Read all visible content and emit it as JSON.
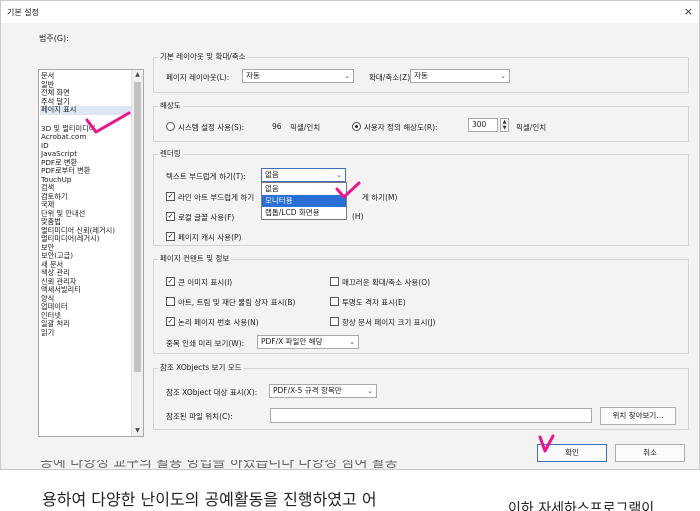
{
  "window": {
    "title": "기본 설정",
    "close_glyph": "×"
  },
  "categories": {
    "label": "범주(G):",
    "group1": [
      "문서",
      "일반",
      "전체 화면",
      "주석 달기",
      "페이지 표시"
    ],
    "group2": [
      "3D 및 멀티미디어",
      "Acrobat.com",
      "ID",
      "JavaScript",
      "PDF로 변환",
      "PDF로부터 변환",
      "TouchUp",
      "검색",
      "검토하기",
      "국제",
      "단위 및 안내선",
      "맞춤법",
      "멀티미디어 신뢰(레거시)",
      "멀티미디어(레거시)",
      "보안",
      "보안(고급)",
      "새 문서",
      "색상 관리",
      "신뢰 관리자",
      "액세서빌리티",
      "양식",
      "업데이터",
      "인터넷",
      "일괄 처리",
      "읽기"
    ],
    "selected": "페이지 표시"
  },
  "layout_zoom": {
    "title": "기본 레이아웃 및 확대/축소",
    "page_layout_label": "페이지 레이아웃(L):",
    "page_layout_value": "자동",
    "zoom_label": "확대/축소(Z):",
    "zoom_value": "자동"
  },
  "resolution": {
    "title": "해상도",
    "system_label": "시스템 설정 사용(S):",
    "system_value": "96",
    "system_unit": "픽셀/인치",
    "custom_label": "사용자 정의 해상도(R):",
    "custom_value": "300",
    "custom_unit": "픽셀/인치",
    "selected": "custom"
  },
  "rendering": {
    "title": "렌더링",
    "smooth_text_label": "텍스트 부드럽게 하기(T):",
    "smooth_text_value": "없음",
    "options": [
      "없음",
      "모니터용",
      "랩톱/LCD 화면용"
    ],
    "highlighted_option": "모니터용",
    "line_art_label": "라인 아트 부드럽게 하기",
    "image_smooth_label": "게 하기(M)",
    "local_fonts_label": "로컬 글꼴 사용(F)",
    "hidden_right_label": "(H)",
    "page_cache_label": "페이지 캐시 사용(P)"
  },
  "page_content": {
    "title": "페이지 컨텐트 및 정보",
    "large_images_label": "큰 이미지 표시(I)",
    "smooth_zoom_label": "매끄러운 확대/축소 사용(O)",
    "art_trim_label": "아트, 트림 및 재단 물림 상자 표시(B)",
    "transparency_grid_label": "투명도 격자 표시(E)",
    "logical_page_label": "논리 페이지 번호 사용(N)",
    "doc_page_size_label": "항상 문서 페이지 크기 표시(J)",
    "overprint_label": "중복 인쇄 미리 보기(W):",
    "overprint_value": "PDF/X 파일만 해당"
  },
  "xobjects": {
    "title": "참조 XObjects 보기 모드",
    "show_target_label": "참조 XObject 대상 표시(X):",
    "show_target_value": "PDF/X-5 규격 항목만",
    "file_location_label": "참조된 파일 위치(C):",
    "browse_label": "위치 찾아보기..."
  },
  "buttons": {
    "ok": "확인",
    "cancel": "취소"
  },
  "background_text": {
    "line": "용하여 다양한 난이도의 공예활동을 진행하였고 어",
    "fragment": "이하 자세하스프로그램이",
    "partial_top": "공예 다양성 교구의 활용 방법을 하였습니다 다양성 참여 활동"
  },
  "accent": {
    "annotation": "#e8188c",
    "focus": "#3b6fc0",
    "highlight": "#2a6fd6"
  }
}
